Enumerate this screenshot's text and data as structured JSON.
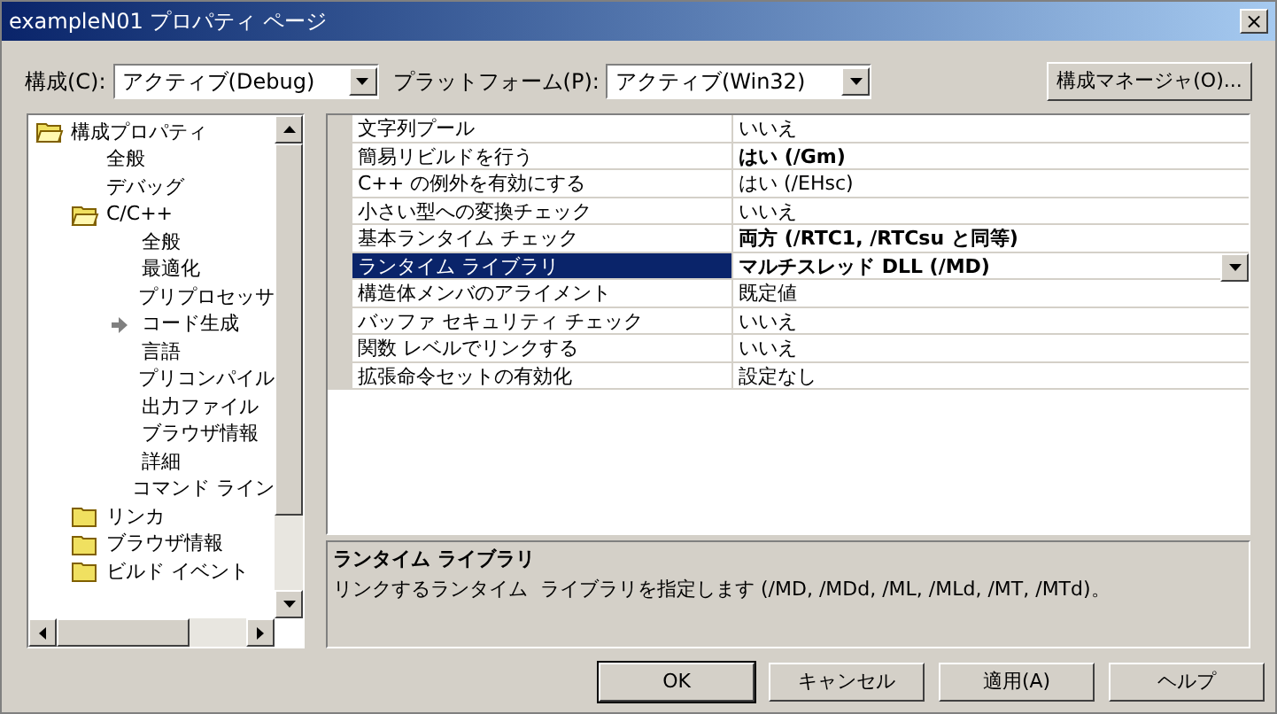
{
  "window": {
    "title": "exampleN01 プロパティ ページ",
    "close": "×"
  },
  "toolbar": {
    "config_label": "構成(C):",
    "config_value": "アクティブ(Debug)",
    "platform_label": "プラットフォーム(P):",
    "platform_value": "アクティブ(Win32)",
    "manager_button": "構成マネージャ(O)..."
  },
  "tree": [
    {
      "label": "構成プロパティ",
      "kind": "folder",
      "expanded": true,
      "children": [
        {
          "label": "全般",
          "kind": "page",
          "selected": false
        },
        {
          "label": "デバッグ",
          "kind": "page",
          "selected": false
        },
        {
          "label": "C/C++",
          "kind": "folder",
          "expanded": true,
          "children": [
            {
              "label": "全般",
              "kind": "page",
              "selected": false
            },
            {
              "label": "最適化",
              "kind": "page",
              "selected": false
            },
            {
              "label": "プリプロセッサ",
              "kind": "page",
              "selected": false
            },
            {
              "label": "コード生成",
              "kind": "page",
              "selected": true
            },
            {
              "label": "言語",
              "kind": "page",
              "selected": false
            },
            {
              "label": "プリコンパイル",
              "kind": "page",
              "selected": false
            },
            {
              "label": "出力ファイル",
              "kind": "page",
              "selected": false
            },
            {
              "label": "ブラウザ情報",
              "kind": "page",
              "selected": false
            },
            {
              "label": "詳細",
              "kind": "page",
              "selected": false
            },
            {
              "label": "コマンド ライン",
              "kind": "page",
              "selected": false
            }
          ]
        },
        {
          "label": "リンカ",
          "kind": "folder",
          "expanded": false
        },
        {
          "label": "ブラウザ情報",
          "kind": "folder",
          "expanded": false
        },
        {
          "label": "ビルド イベント",
          "kind": "folder",
          "expanded": false
        }
      ]
    }
  ],
  "properties": [
    {
      "name": "文字列プール",
      "value": "いいえ",
      "bold": false,
      "selected": false
    },
    {
      "name": "簡易リビルドを行う",
      "value": "はい (/Gm)",
      "bold": true,
      "selected": false
    },
    {
      "name": "C++ の例外を有効にする",
      "value": "はい (/EHsc)",
      "bold": false,
      "selected": false
    },
    {
      "name": "小さい型への変換チェック",
      "value": "いいえ",
      "bold": false,
      "selected": false
    },
    {
      "name": "基本ランタイム チェック",
      "value": "両方 (/RTC1, /RTCsu と同等)",
      "bold": true,
      "selected": false
    },
    {
      "name": "ランタイム ライブラリ",
      "value": "マルチスレッド DLL (/MD)",
      "bold": true,
      "selected": true
    },
    {
      "name": "構造体メンバのアライメント",
      "value": "既定値",
      "bold": false,
      "selected": false
    },
    {
      "name": "バッファ セキュリティ チェック",
      "value": "いいえ",
      "bold": false,
      "selected": false
    },
    {
      "name": "関数 レベルでリンクする",
      "value": "いいえ",
      "bold": false,
      "selected": false
    },
    {
      "name": "拡張命令セットの有効化",
      "value": "設定なし",
      "bold": false,
      "selected": false
    }
  ],
  "description": {
    "title": "ランタイム ライブラリ",
    "text": "リンクするランタイム  ライブラリを指定します (/MD, /MDd, /ML, /MLd, /MT, /MTd)。"
  },
  "buttons": [
    {
      "label": "OK",
      "default": true
    },
    {
      "label": "キャンセル",
      "default": false
    },
    {
      "label": "適用(A)",
      "default": false
    },
    {
      "label": "ヘルプ",
      "default": false
    }
  ]
}
